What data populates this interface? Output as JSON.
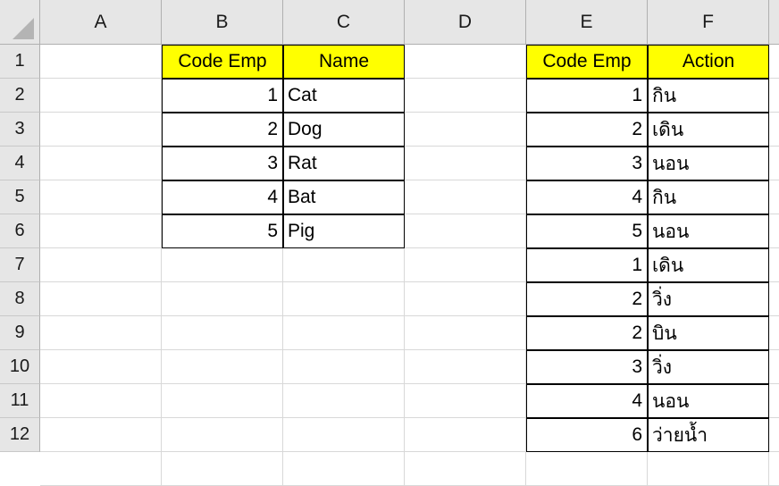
{
  "app": {
    "type": "spreadsheet",
    "accent_header_fill": "#ffff00",
    "header_band_fill": "#e6e6e6",
    "gridline_color": "#d8d8d8",
    "table_border_color": "#000000"
  },
  "corner": {
    "name": "select-all"
  },
  "columns": [
    {
      "id": "A",
      "label": "A"
    },
    {
      "id": "B",
      "label": "B"
    },
    {
      "id": "C",
      "label": "C"
    },
    {
      "id": "D",
      "label": "D"
    },
    {
      "id": "E",
      "label": "E"
    },
    {
      "id": "F",
      "label": "F"
    }
  ],
  "rows": [
    {
      "label": "1"
    },
    {
      "label": "2"
    },
    {
      "label": "3"
    },
    {
      "label": "4"
    },
    {
      "label": "5"
    },
    {
      "label": "6"
    },
    {
      "label": "7"
    },
    {
      "label": "8"
    },
    {
      "label": "9"
    },
    {
      "label": "10"
    },
    {
      "label": "11"
    },
    {
      "label": "12"
    }
  ],
  "table_left": {
    "header": {
      "code": "Code Emp",
      "name": "Name"
    },
    "rows": [
      {
        "code": "1",
        "name": "Cat"
      },
      {
        "code": "2",
        "name": "Dog"
      },
      {
        "code": "3",
        "name": "Rat"
      },
      {
        "code": "4",
        "name": "Bat"
      },
      {
        "code": "5",
        "name": "Pig"
      }
    ]
  },
  "table_right": {
    "header": {
      "code": "Code Emp",
      "action": "Action"
    },
    "rows": [
      {
        "code": "1",
        "action": "กิน"
      },
      {
        "code": "2",
        "action": "เดิน"
      },
      {
        "code": "3",
        "action": "นอน"
      },
      {
        "code": "4",
        "action": "กิน"
      },
      {
        "code": "5",
        "action": "นอน"
      },
      {
        "code": "1",
        "action": "เดิน"
      },
      {
        "code": "2",
        "action": "วิ่ง"
      },
      {
        "code": "2",
        "action": "บิน"
      },
      {
        "code": "3",
        "action": "วิ่ง"
      },
      {
        "code": "4",
        "action": "นอน"
      },
      {
        "code": "6",
        "action": "ว่ายน้ำ"
      }
    ]
  }
}
